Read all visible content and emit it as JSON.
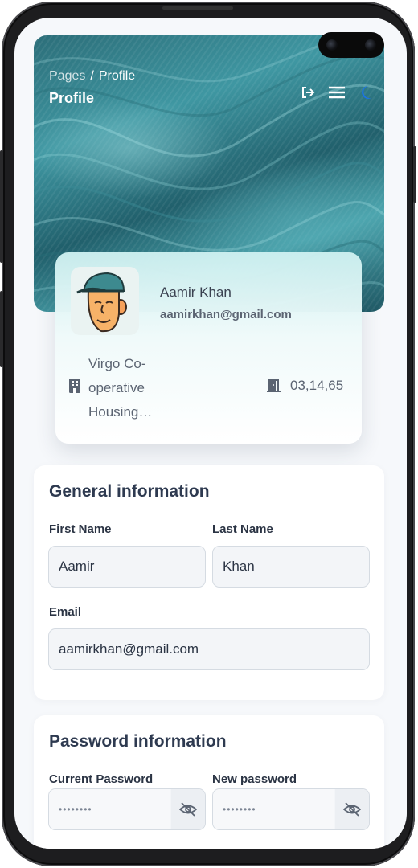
{
  "breadcrumb": {
    "root": "Pages",
    "separator": "/",
    "current": "Profile"
  },
  "header": {
    "title": "Profile",
    "icons": [
      "logout-icon",
      "menu-icon",
      "dark-mode-icon"
    ]
  },
  "profile": {
    "name": "Aamir Khan",
    "email": "aamirkhan@gmail.com",
    "address": "Virgo Co-operative Housing Society",
    "code": "03,14,65"
  },
  "general": {
    "title": "General information",
    "first_name_label": "First Name",
    "first_name_value": "Aamir",
    "last_name_label": "Last Name",
    "last_name_value": "Khan",
    "email_label": "Email",
    "email_value": "aamirkhan@gmail.com"
  },
  "password": {
    "title": "Password information",
    "current_label": "Current Password",
    "current_value": "••••••••",
    "new_label": "New password",
    "new_value": "••••••••"
  },
  "colors": {
    "accent": "#1a73e8",
    "heading": "#2e3a50",
    "hero": "#3f97a2"
  }
}
